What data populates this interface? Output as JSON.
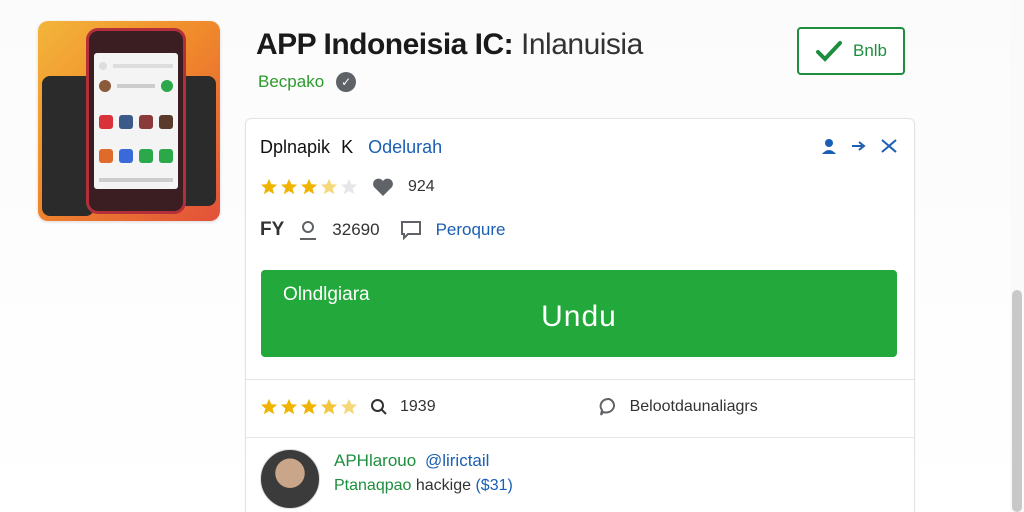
{
  "header": {
    "title_bold": "APP Indoneisia IC:",
    "title_light": "Inlanuisia",
    "developer": "Becpako",
    "follow_label": "Bnlb"
  },
  "card": {
    "head_name": "Dplnapik",
    "head_tag": "K",
    "head_link": "Odelurah",
    "rating_count": "924",
    "age_tag": "FY",
    "downloads": "32690",
    "category": "Peroqure",
    "install_small": "Olndlgiara",
    "install_big": "Undu",
    "reviews_count": "1939",
    "reviews_label": "Belootdaunaliagrs",
    "author_name": "APHlarouo",
    "author_handle": "@lirictail",
    "author_desc": "Ptanaqpao",
    "author_pkg": "hackige",
    "author_price": "($31)"
  },
  "icons": {
    "developer_badge": "info-icon",
    "follow": "check-icon",
    "head_user": "user-icon",
    "head_share": "share-icon",
    "head_tools": "tools-icon",
    "heart": "heart-icon",
    "download": "person-icon",
    "category": "comment-icon",
    "search": "search-icon",
    "reviews": "comment-icon"
  },
  "colors": {
    "accent_green": "#22a83b",
    "link_blue": "#1a5fb4",
    "star_gold": "#f0b400"
  }
}
